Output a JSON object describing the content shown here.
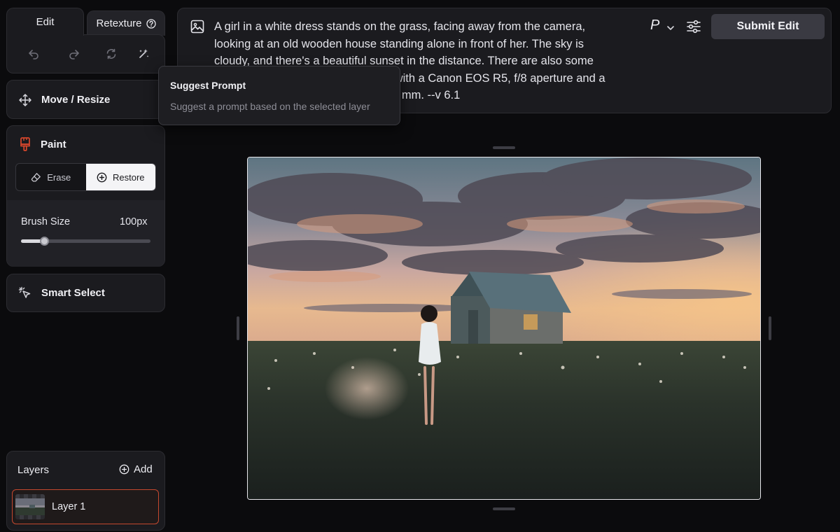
{
  "tabs": {
    "edit": "Edit",
    "retexture": "Retexture"
  },
  "toolbar": {
    "undo": "undo-icon",
    "redo": "redo-icon",
    "refresh": "refresh-icon",
    "suggest": "sparkle-wand-icon"
  },
  "tools": {
    "move_resize": "Move / Resize",
    "paint": "Paint",
    "erase": "Erase",
    "restore": "Restore",
    "brush_size_label": "Brush Size",
    "brush_size_value": "100px",
    "brush_size_fraction": 0.18,
    "smart_select": "Smart Select"
  },
  "prompt": {
    "text": "A girl in a white dress stands on the grass, facing away from the camera, looking at an old wooden house standing alone in front of her. The sky is cloudy, and there's a beautiful sunset in the distance. There are also some wildflowers on the grass. Captured with a Canon EOS R5, f/8 aperture and a shutter speed of 1/250 second at 36 mm. --v 6.1",
    "mode_letter": "P",
    "submit": "Submit Edit"
  },
  "tooltip": {
    "title": "Suggest Prompt",
    "description": "Suggest a prompt based on the selected layer"
  },
  "layers": {
    "title": "Layers",
    "add": "Add",
    "items": [
      {
        "name": "Layer 1"
      }
    ]
  },
  "colors": {
    "accent_red": "#d8472c",
    "panel": "#1b1b1f",
    "background": "#0b0b0d"
  }
}
